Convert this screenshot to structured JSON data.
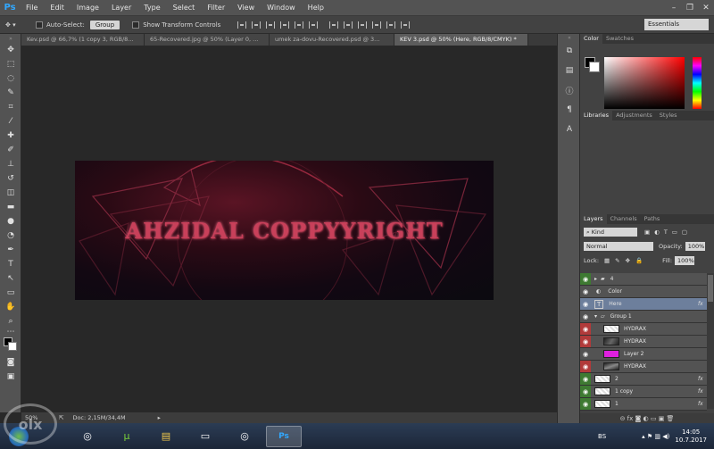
{
  "app": {
    "logo": "Ps",
    "accent": "#31a8ff"
  },
  "menu": [
    "File",
    "Edit",
    "Image",
    "Layer",
    "Type",
    "Select",
    "Filter",
    "View",
    "Window",
    "Help"
  ],
  "window_controls": [
    "–",
    "❐",
    "✕"
  ],
  "options": {
    "auto_select_label": "Auto-Select:",
    "auto_select_value": "Group",
    "transform_label": "Show Transform Controls",
    "workspace": "Essentials"
  },
  "tabs": [
    {
      "label": "Kev.psd @ 66,7% (1 copy 3, RGB/8...",
      "active": false
    },
    {
      "label": "65-Recovered.jpg @ 50% (Layer 0, ...",
      "active": false
    },
    {
      "label": "umek za-dovu-Recovered.psd @ 3...",
      "active": false
    },
    {
      "label": "KEV 3.psd @ 50% (Here, RGB/8/CMYK) *",
      "active": true
    }
  ],
  "artwork": {
    "text": "AHZIDAL COPPYYRIGHT"
  },
  "status": {
    "zoom": "50%",
    "doc": "Doc: 2,15M/34,4M"
  },
  "panels": {
    "color_tabs": [
      "Color",
      "Swatches"
    ],
    "libraries_tabs": [
      "Libraries",
      "Adjustments",
      "Styles"
    ],
    "layers_tabs": [
      "Layers",
      "Channels",
      "Paths"
    ],
    "kind": "Kind",
    "blend_mode": "Normal",
    "opacity_label": "Opacity:",
    "opacity": "100%",
    "lock_label": "Lock:",
    "fill_label": "Fill:",
    "fill": "100%"
  },
  "layers": [
    {
      "name": "4",
      "eye": "green",
      "type": "folder",
      "fx": ""
    },
    {
      "name": "Color",
      "eye": "plain",
      "type": "adjust",
      "fx": ""
    },
    {
      "name": "Here",
      "eye": "plain",
      "type": "text",
      "fx": "fx",
      "selected": true
    },
    {
      "name": "Group 1",
      "eye": "plain",
      "type": "group",
      "fx": ""
    },
    {
      "name": "HYDRAX",
      "eye": "red",
      "type": "checker",
      "fx": ""
    },
    {
      "name": "HYDRAX",
      "eye": "red",
      "type": "dark",
      "fx": ""
    },
    {
      "name": "Layer 2",
      "eye": "plain",
      "type": "magenta",
      "fx": ""
    },
    {
      "name": "HYDRAX",
      "eye": "red",
      "type": "dark",
      "fx": ""
    },
    {
      "name": "2",
      "eye": "green",
      "type": "checker",
      "fx": "fx"
    },
    {
      "name": "1 copy",
      "eye": "green",
      "type": "checker",
      "fx": "fx"
    },
    {
      "name": "1",
      "eye": "green",
      "type": "checker",
      "fx": "fx"
    }
  ],
  "layers_footer": "⊝  fx  ◙  ◐  ▭  ▣  🗑",
  "taskbar": {
    "apps": [
      "chrome-icon",
      "utorrent-icon",
      "explorer-icon",
      "screen-icon",
      "chrome-icon",
      "photoshop-icon"
    ],
    "language": "BS",
    "time": "14:05",
    "date": "10.7.2017"
  },
  "watermark": "olx"
}
